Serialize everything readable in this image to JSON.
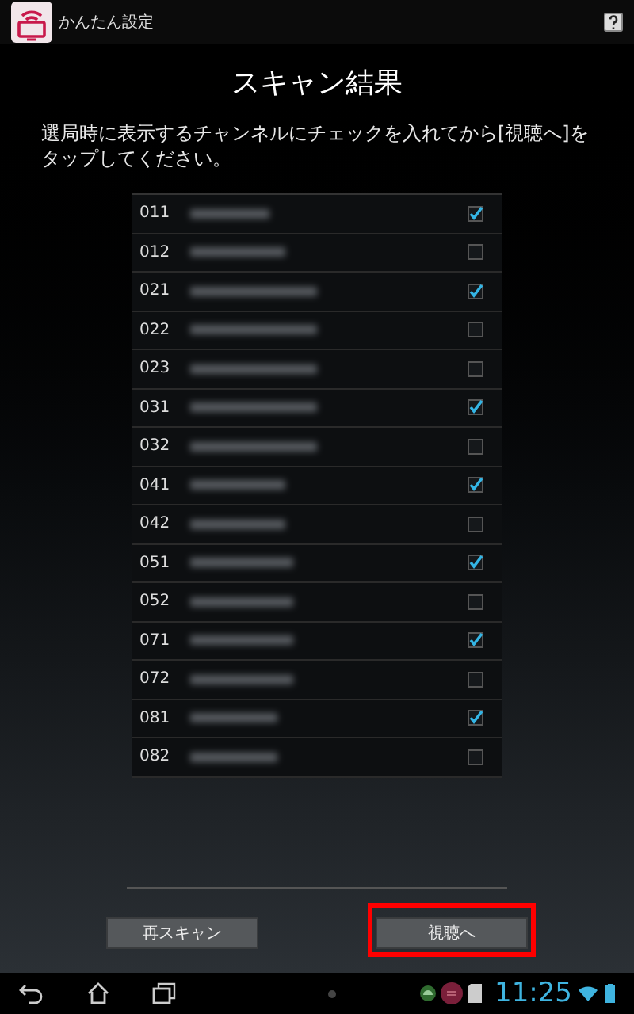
{
  "app_bar": {
    "title": "かんたん設定"
  },
  "heading": "スキャン結果",
  "instruction": "選局時に表示するチャンネルにチェックを入れてから[視聴へ]をタップしてください。",
  "channels": [
    {
      "number": "011",
      "checked": true
    },
    {
      "number": "012",
      "checked": false
    },
    {
      "number": "021",
      "checked": true
    },
    {
      "number": "022",
      "checked": false
    },
    {
      "number": "023",
      "checked": false
    },
    {
      "number": "031",
      "checked": true
    },
    {
      "number": "032",
      "checked": false
    },
    {
      "number": "041",
      "checked": true
    },
    {
      "number": "042",
      "checked": false
    },
    {
      "number": "051",
      "checked": true
    },
    {
      "number": "052",
      "checked": false
    },
    {
      "number": "071",
      "checked": true
    },
    {
      "number": "072",
      "checked": false
    },
    {
      "number": "081",
      "checked": true
    },
    {
      "number": "082",
      "checked": false
    }
  ],
  "buttons": [
    {
      "label": "再スキャン",
      "highlighted": false
    },
    {
      "label": "視聴へ",
      "highlighted": true
    }
  ],
  "status_bar": {
    "time": "11:25"
  }
}
